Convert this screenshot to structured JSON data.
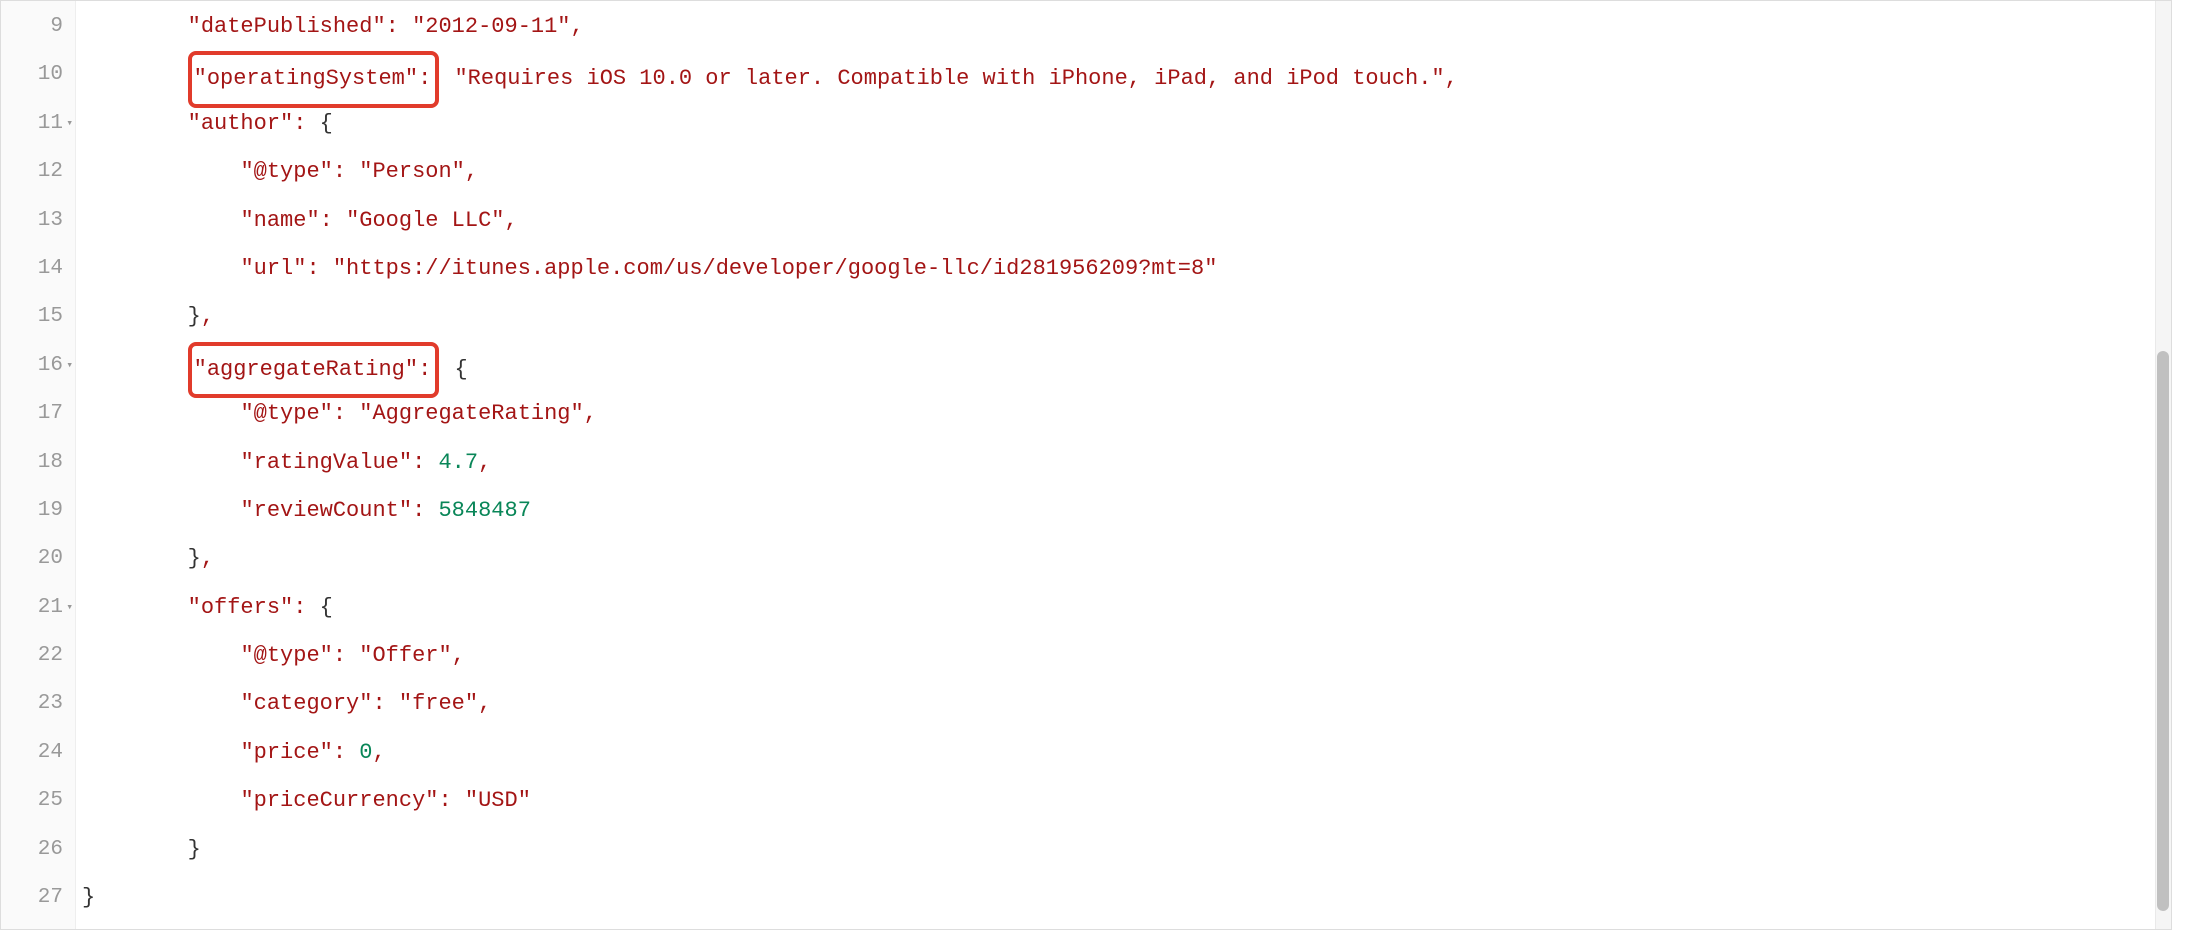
{
  "lines": [
    {
      "num": "9",
      "fold": "",
      "indent": 2,
      "key": "\"datePublished\"",
      "boxed": false,
      "value_type": "string",
      "value": "\"2012-09-11\"",
      "trailing_comma": true
    },
    {
      "num": "10",
      "fold": "",
      "indent": 2,
      "key": "\"operatingSystem\"",
      "boxed": true,
      "value_type": "string",
      "value": "\"Requires iOS 10.0 or later. Compatible with iPhone, iPad, and iPod touch.\"",
      "trailing_comma": true
    },
    {
      "num": "11",
      "fold": "▾",
      "indent": 2,
      "key": "\"author\"",
      "boxed": false,
      "value_type": "open",
      "value": "{",
      "trailing_comma": false
    },
    {
      "num": "12",
      "fold": "",
      "indent": 3,
      "key": "\"@type\"",
      "boxed": false,
      "value_type": "string",
      "value": "\"Person\"",
      "trailing_comma": true
    },
    {
      "num": "13",
      "fold": "",
      "indent": 3,
      "key": "\"name\"",
      "boxed": false,
      "value_type": "string",
      "value": "\"Google LLC\"",
      "trailing_comma": true
    },
    {
      "num": "14",
      "fold": "",
      "indent": 3,
      "key": "\"url\"",
      "boxed": false,
      "value_type": "string",
      "value": "\"https://itunes.apple.com/us/developer/google-llc/id281956209?mt=8\"",
      "trailing_comma": false
    },
    {
      "num": "15",
      "fold": "",
      "indent": 2,
      "key": "",
      "boxed": false,
      "value_type": "close",
      "value": "}",
      "trailing_comma": true
    },
    {
      "num": "16",
      "fold": "▾",
      "indent": 2,
      "key": "\"aggregateRating\"",
      "boxed": true,
      "value_type": "open",
      "value": "{",
      "trailing_comma": false
    },
    {
      "num": "17",
      "fold": "",
      "indent": 3,
      "key": "\"@type\"",
      "boxed": false,
      "value_type": "string",
      "value": "\"AggregateRating\"",
      "trailing_comma": true
    },
    {
      "num": "18",
      "fold": "",
      "indent": 3,
      "key": "\"ratingValue\"",
      "boxed": false,
      "value_type": "number",
      "value": "4.7",
      "trailing_comma": true
    },
    {
      "num": "19",
      "fold": "",
      "indent": 3,
      "key": "\"reviewCount\"",
      "boxed": false,
      "value_type": "number",
      "value": "5848487",
      "trailing_comma": false
    },
    {
      "num": "20",
      "fold": "",
      "indent": 2,
      "key": "",
      "boxed": false,
      "value_type": "close",
      "value": "}",
      "trailing_comma": true
    },
    {
      "num": "21",
      "fold": "▾",
      "indent": 2,
      "key": "\"offers\"",
      "boxed": false,
      "value_type": "open",
      "value": "{",
      "trailing_comma": false
    },
    {
      "num": "22",
      "fold": "",
      "indent": 3,
      "key": "\"@type\"",
      "boxed": false,
      "value_type": "string",
      "value": "\"Offer\"",
      "trailing_comma": true
    },
    {
      "num": "23",
      "fold": "",
      "indent": 3,
      "key": "\"category\"",
      "boxed": false,
      "value_type": "string",
      "value": "\"free\"",
      "trailing_comma": true
    },
    {
      "num": "24",
      "fold": "",
      "indent": 3,
      "key": "\"price\"",
      "boxed": false,
      "value_type": "number",
      "value": "0",
      "trailing_comma": true
    },
    {
      "num": "25",
      "fold": "",
      "indent": 3,
      "key": "\"priceCurrency\"",
      "boxed": false,
      "value_type": "string",
      "value": "\"USD\"",
      "trailing_comma": false
    },
    {
      "num": "26",
      "fold": "",
      "indent": 2,
      "key": "",
      "boxed": false,
      "value_type": "close",
      "value": "}",
      "trailing_comma": false
    },
    {
      "num": "27",
      "fold": "",
      "indent": 0,
      "key": "",
      "boxed": false,
      "value_type": "close",
      "value": "}",
      "trailing_comma": false
    }
  ]
}
